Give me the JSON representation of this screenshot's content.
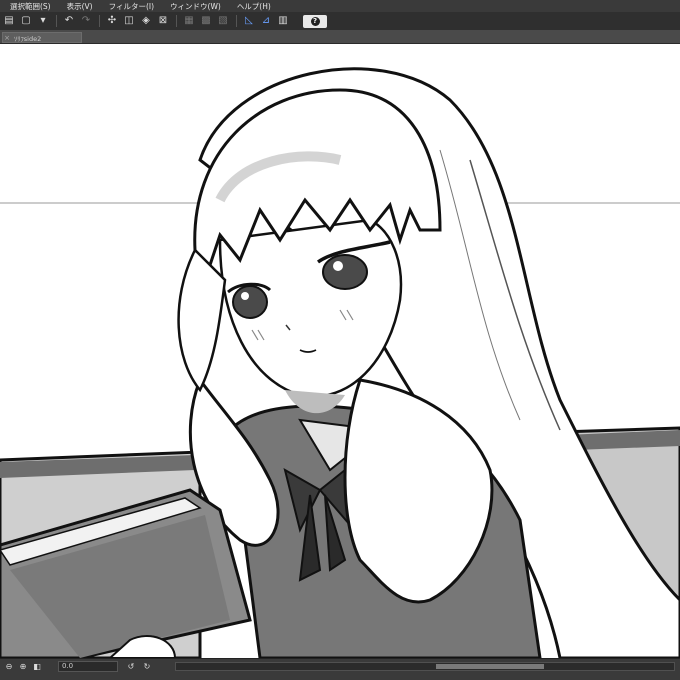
{
  "menu": {
    "items": [
      "選択範囲(S)",
      "表示(V)",
      "フィルター(I)",
      "ウィンドウ(W)",
      "ヘルプ(H)"
    ]
  },
  "toolbar": {
    "buttons": [
      {
        "icon": "new-file-icon",
        "glyph": "▤"
      },
      {
        "icon": "save-icon",
        "glyph": "▢"
      },
      {
        "icon": "dropdown-icon",
        "glyph": "▾"
      },
      {
        "icon": "undo-icon",
        "glyph": "↶"
      },
      {
        "icon": "redo-icon",
        "glyph": "↷"
      },
      {
        "icon": "transform-icon",
        "glyph": "✣"
      },
      {
        "icon": "select-icon",
        "glyph": "◫"
      },
      {
        "icon": "fill-icon",
        "glyph": "◈"
      },
      {
        "icon": "crop-icon",
        "glyph": "⊠"
      },
      {
        "icon": "layer-a-icon",
        "glyph": "▦"
      },
      {
        "icon": "layer-b-icon",
        "glyph": "▩"
      },
      {
        "icon": "layer-c-icon",
        "glyph": "▧"
      },
      {
        "icon": "ruler-icon",
        "glyph": "◺"
      },
      {
        "icon": "snap-icon",
        "glyph": "⊿"
      },
      {
        "icon": "grid-icon",
        "glyph": "▥"
      }
    ],
    "help_label": "?"
  },
  "tabs": [
    {
      "label": "ｿﾘﾌside2",
      "close": "×"
    }
  ],
  "statusbar": {
    "buttons": [
      "⊖",
      "⊕",
      "◧"
    ],
    "zoom_value": "0.0",
    "rotate_left": "↺",
    "rotate_right": "↻"
  },
  "colors": {
    "chrome_dark": "#2f2f2f",
    "menubar": "#3a3a3a",
    "tab_active": "#5e5e5e",
    "canvas": "#ffffff"
  }
}
